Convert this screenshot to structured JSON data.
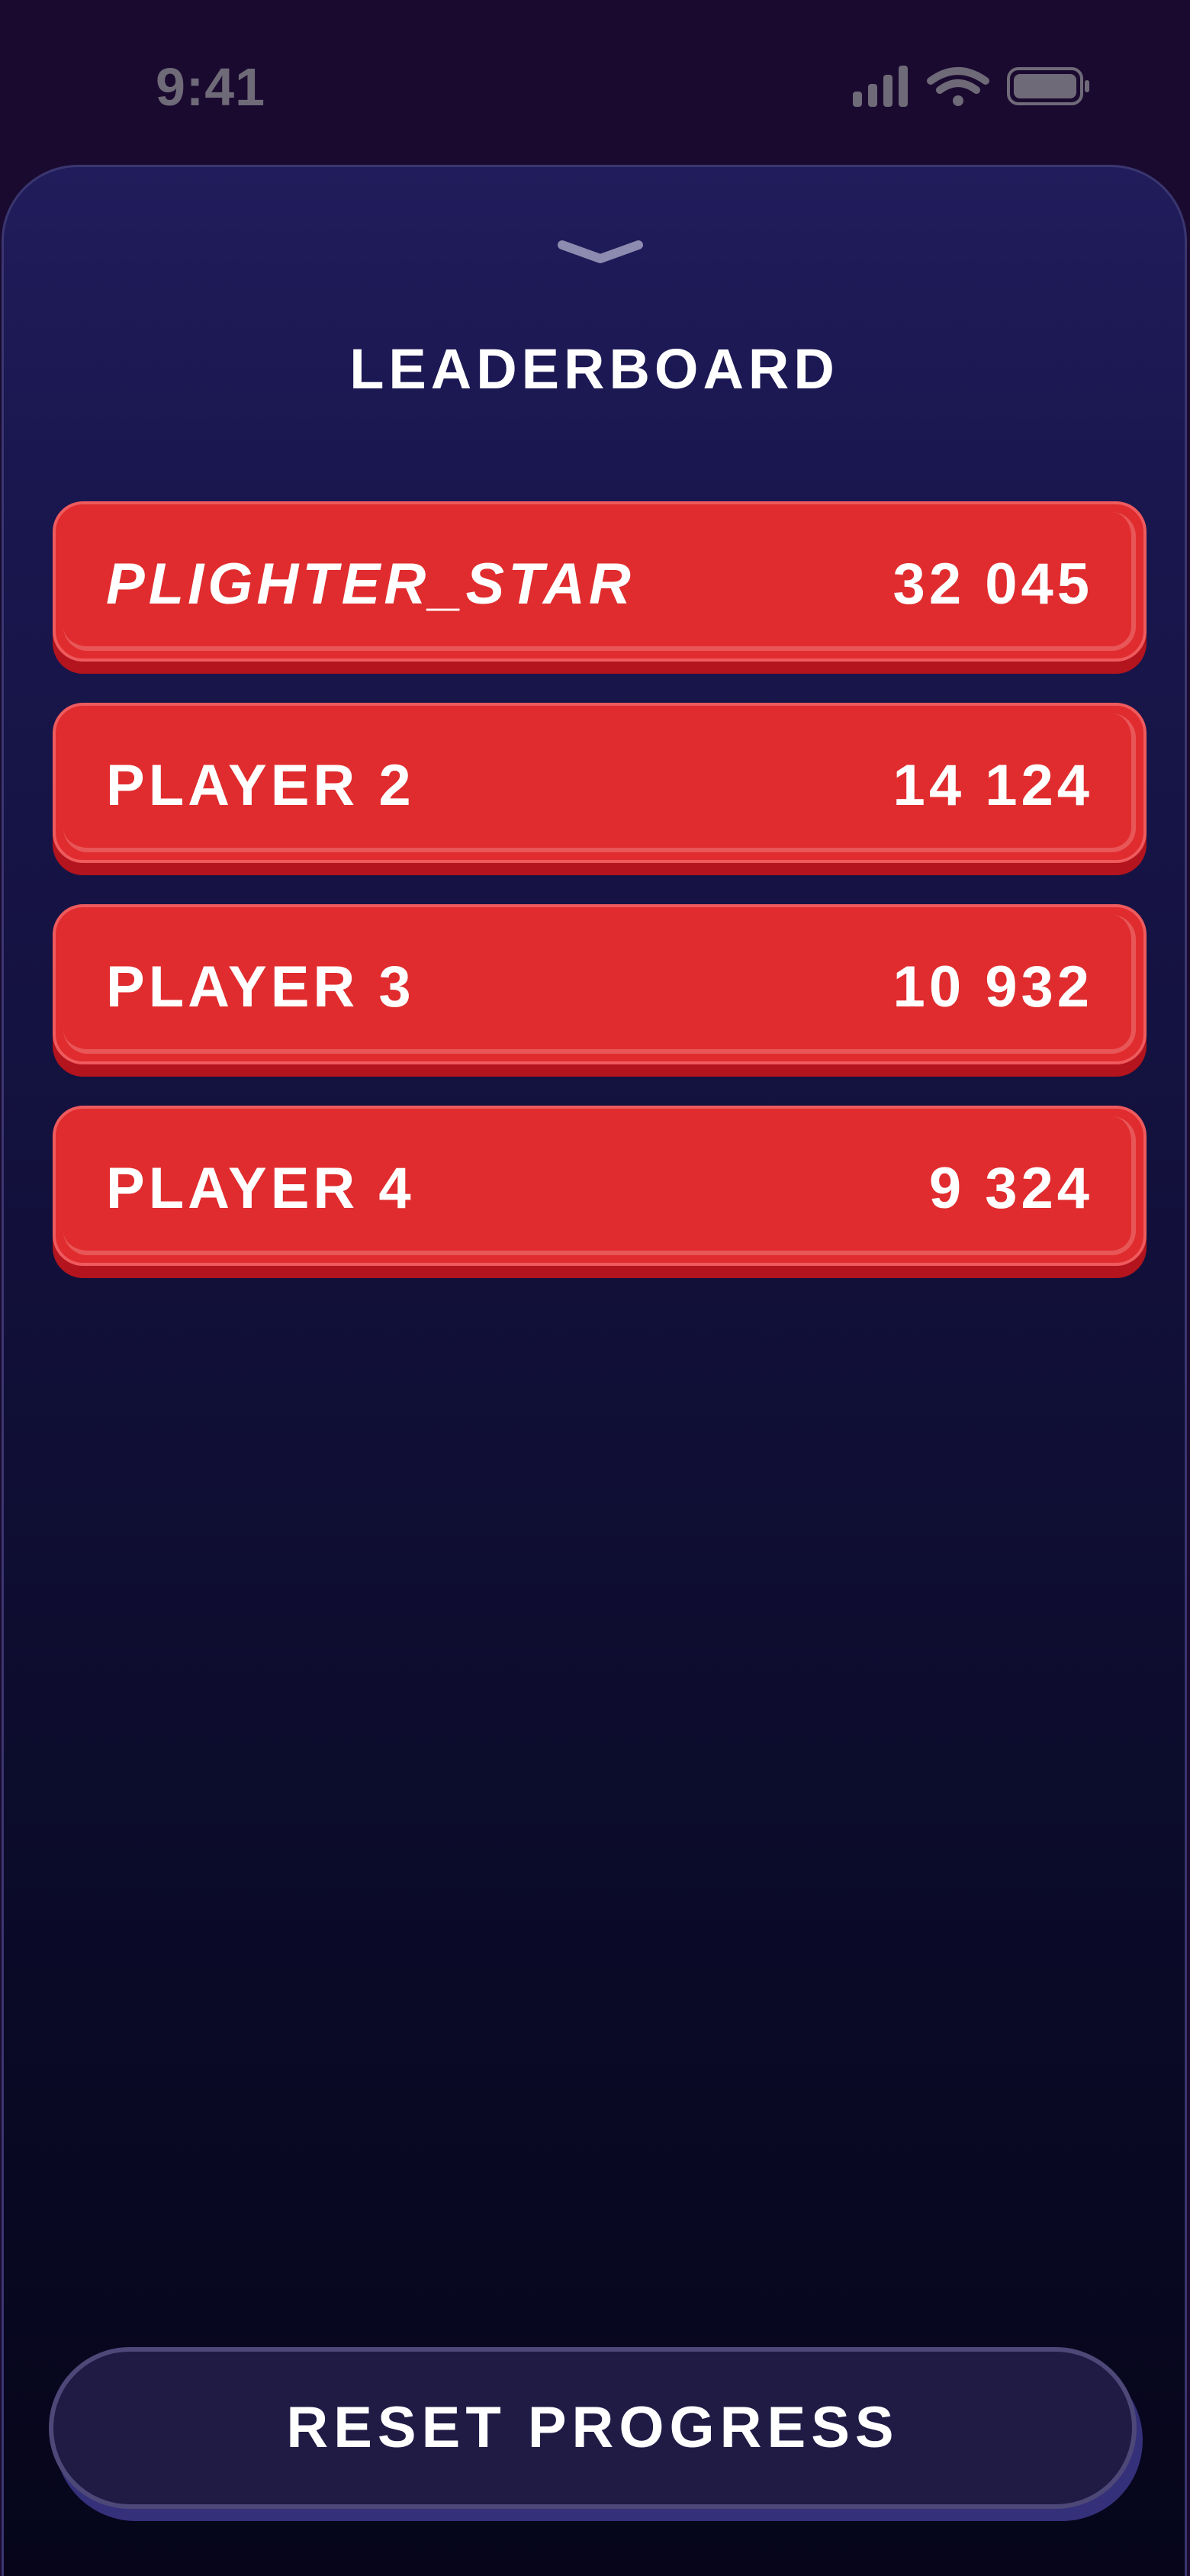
{
  "status_bar": {
    "time": "9:41",
    "icons": [
      "cellular-signal-icon",
      "wifi-icon",
      "battery-icon"
    ]
  },
  "sheet": {
    "grabber_icon": "chevron-down-icon",
    "title": "LEADERBOARD"
  },
  "leaderboard": {
    "rows": [
      {
        "name": "PLIGHTER_STAR",
        "score": "32 045",
        "italic": true
      },
      {
        "name": "PLAYER 2",
        "score": "14 124",
        "italic": false
      },
      {
        "name": "PLAYER 3",
        "score": "10 932",
        "italic": false
      },
      {
        "name": "PLAYER 4",
        "score": "9 324",
        "italic": false
      }
    ]
  },
  "actions": {
    "reset_label": "RESET PROGRESS"
  },
  "colors": {
    "row_fill": "#e02c2e",
    "row_shadow": "#b3141d",
    "sheet_top": "#211c5b",
    "sheet_bottom": "#06051a",
    "button_fill": "#1f1b45"
  }
}
